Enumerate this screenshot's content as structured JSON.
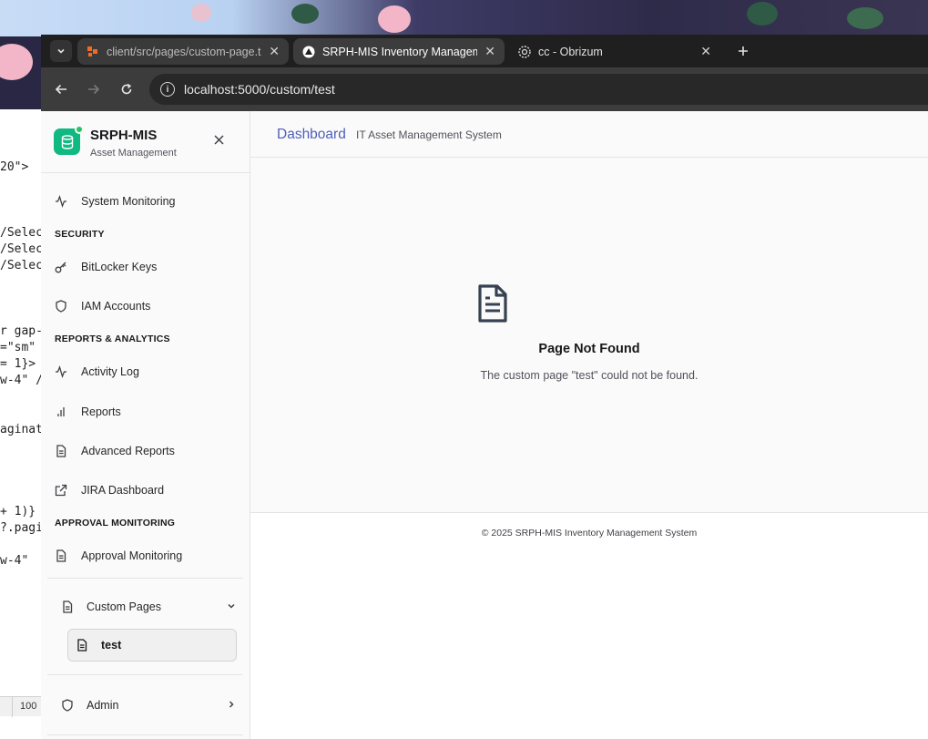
{
  "editor": {
    "lines": [
      "20\">",
      "/Selec",
      "/Selec",
      "/Selec",
      "r gap-",
      "=\"sm\"",
      "= 1}>",
      "w-4\" /",
      "aginat",
      "+ 1)}",
      "?.pagi",
      "w-4\""
    ],
    "zoom": "100"
  },
  "browser": {
    "tabs": [
      {
        "title": "client/src/pages/custom-page.t",
        "favicon": "code-editor-icon",
        "active": false
      },
      {
        "title": "SRPH-MIS Inventory Manageme",
        "favicon": "app-triangle-icon",
        "active": true
      },
      {
        "title": "cc - Obrizum",
        "favicon": "globe-icon",
        "active": false
      }
    ],
    "url": "localhost:5000/custom/test",
    "colors": {
      "tabstrip": "#1f1f1f",
      "toolbar": "#3c3c3c",
      "omnibox": "#282828"
    }
  },
  "sidebar": {
    "brand_title": "SRPH-MIS",
    "brand_subtitle": "Asset Management",
    "items": {
      "system_monitoring": "System Monitoring",
      "bitlocker": "BitLocker Keys",
      "iam": "IAM Accounts",
      "activity_log": "Activity Log",
      "reports": "Reports",
      "advanced_reports": "Advanced Reports",
      "jira": "JIRA Dashboard",
      "approval_monitoring": "Approval Monitoring"
    },
    "sections": {
      "security": "SECURITY",
      "reports_analytics": "REPORTS & ANALYTICS",
      "approval": "APPROVAL MONITORING"
    },
    "custom_pages": {
      "label": "Custom Pages",
      "items": [
        "test"
      ]
    },
    "admin": "Admin",
    "colors": {
      "brand": "#10b981",
      "status_dot": "#22c55e"
    }
  },
  "main": {
    "title": "Dashboard",
    "subtitle": "IT Asset Management System",
    "not_found_title": "Page Not Found",
    "not_found_message": "The custom page \"test\" could not be found.",
    "footer": "© 2025 SRPH-MIS Inventory Management System",
    "colors": {
      "title": "#4f5fb8"
    }
  }
}
